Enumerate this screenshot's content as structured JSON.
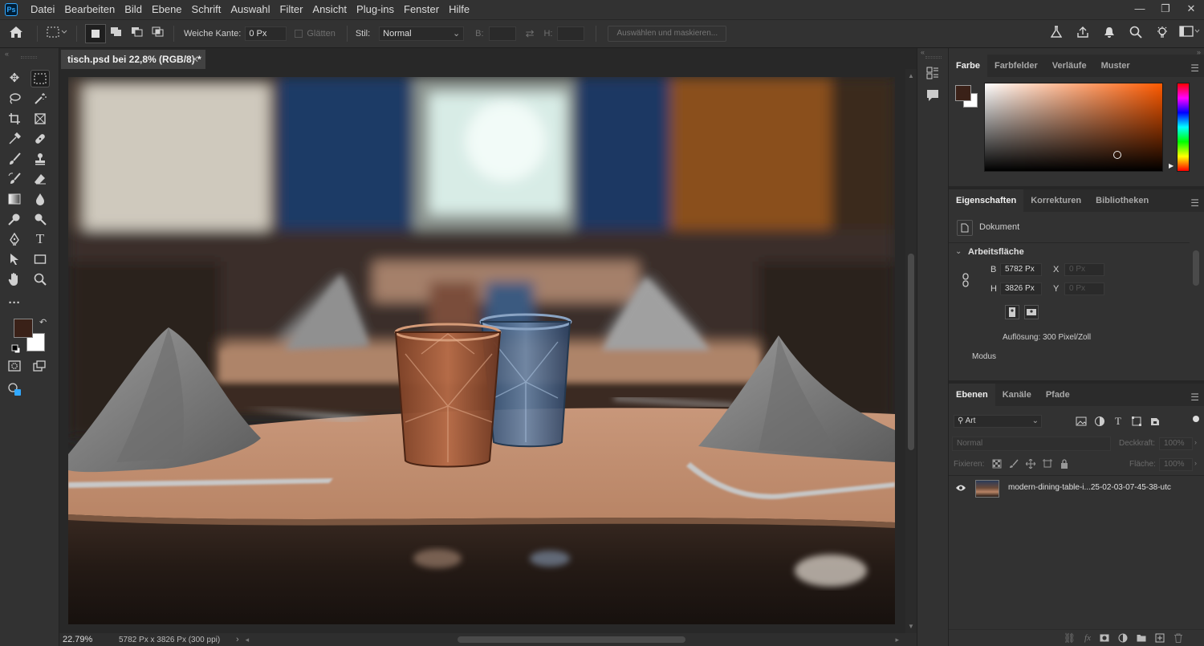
{
  "app": {
    "logo": "Ps"
  },
  "menu": [
    "Datei",
    "Bearbeiten",
    "Bild",
    "Ebene",
    "Schrift",
    "Auswahl",
    "Filter",
    "Ansicht",
    "Plug-ins",
    "Fenster",
    "Hilfe"
  ],
  "window_controls": {
    "minimize": "—",
    "restore": "❐",
    "close": "✕"
  },
  "options": {
    "feather_label": "Weiche Kante:",
    "feather_value": "0 Px",
    "antialias_label": "Glätten",
    "style_label": "Stil:",
    "style_value": "Normal",
    "width_label": "B:",
    "height_label": "H:",
    "select_mask_button": "Auswählen und maskieren..."
  },
  "document": {
    "tab_title": "tisch.psd bei 22,8% (RGB/8) *",
    "zoom": "22.79%",
    "info": "5782 Px x 3826 Px (300 ppi)"
  },
  "colors": {
    "foreground": "#3a2118",
    "background": "#ffffff"
  },
  "color_panel": {
    "tabs": [
      "Farbe",
      "Farbfelder",
      "Verläufe",
      "Muster"
    ]
  },
  "properties_panel": {
    "tabs": [
      "Eigenschaften",
      "Korrekturen",
      "Bibliotheken"
    ],
    "doc_label": "Dokument",
    "section": "Arbeitsfläche",
    "b_label": "B",
    "b_value": "5782 Px",
    "x_label": "X",
    "x_value": "0 Px",
    "h_label": "H",
    "h_value": "3826 Px",
    "y_label": "Y",
    "y_value": "0 Px",
    "resolution": "Auflösung: 300 Pixel/Zoll",
    "mode_label": "Modus"
  },
  "layers_panel": {
    "tabs": [
      "Ebenen",
      "Kanäle",
      "Pfade"
    ],
    "filter": "Art",
    "blend_mode": "Normal",
    "opacity_label": "Deckkraft:",
    "opacity_value": "100%",
    "lock_label": "Fixieren:",
    "fill_label": "Fläche:",
    "fill_value": "100%",
    "layers": [
      {
        "name": "modern-dining-table-i...25-02-03-07-45-38-utc"
      }
    ]
  }
}
